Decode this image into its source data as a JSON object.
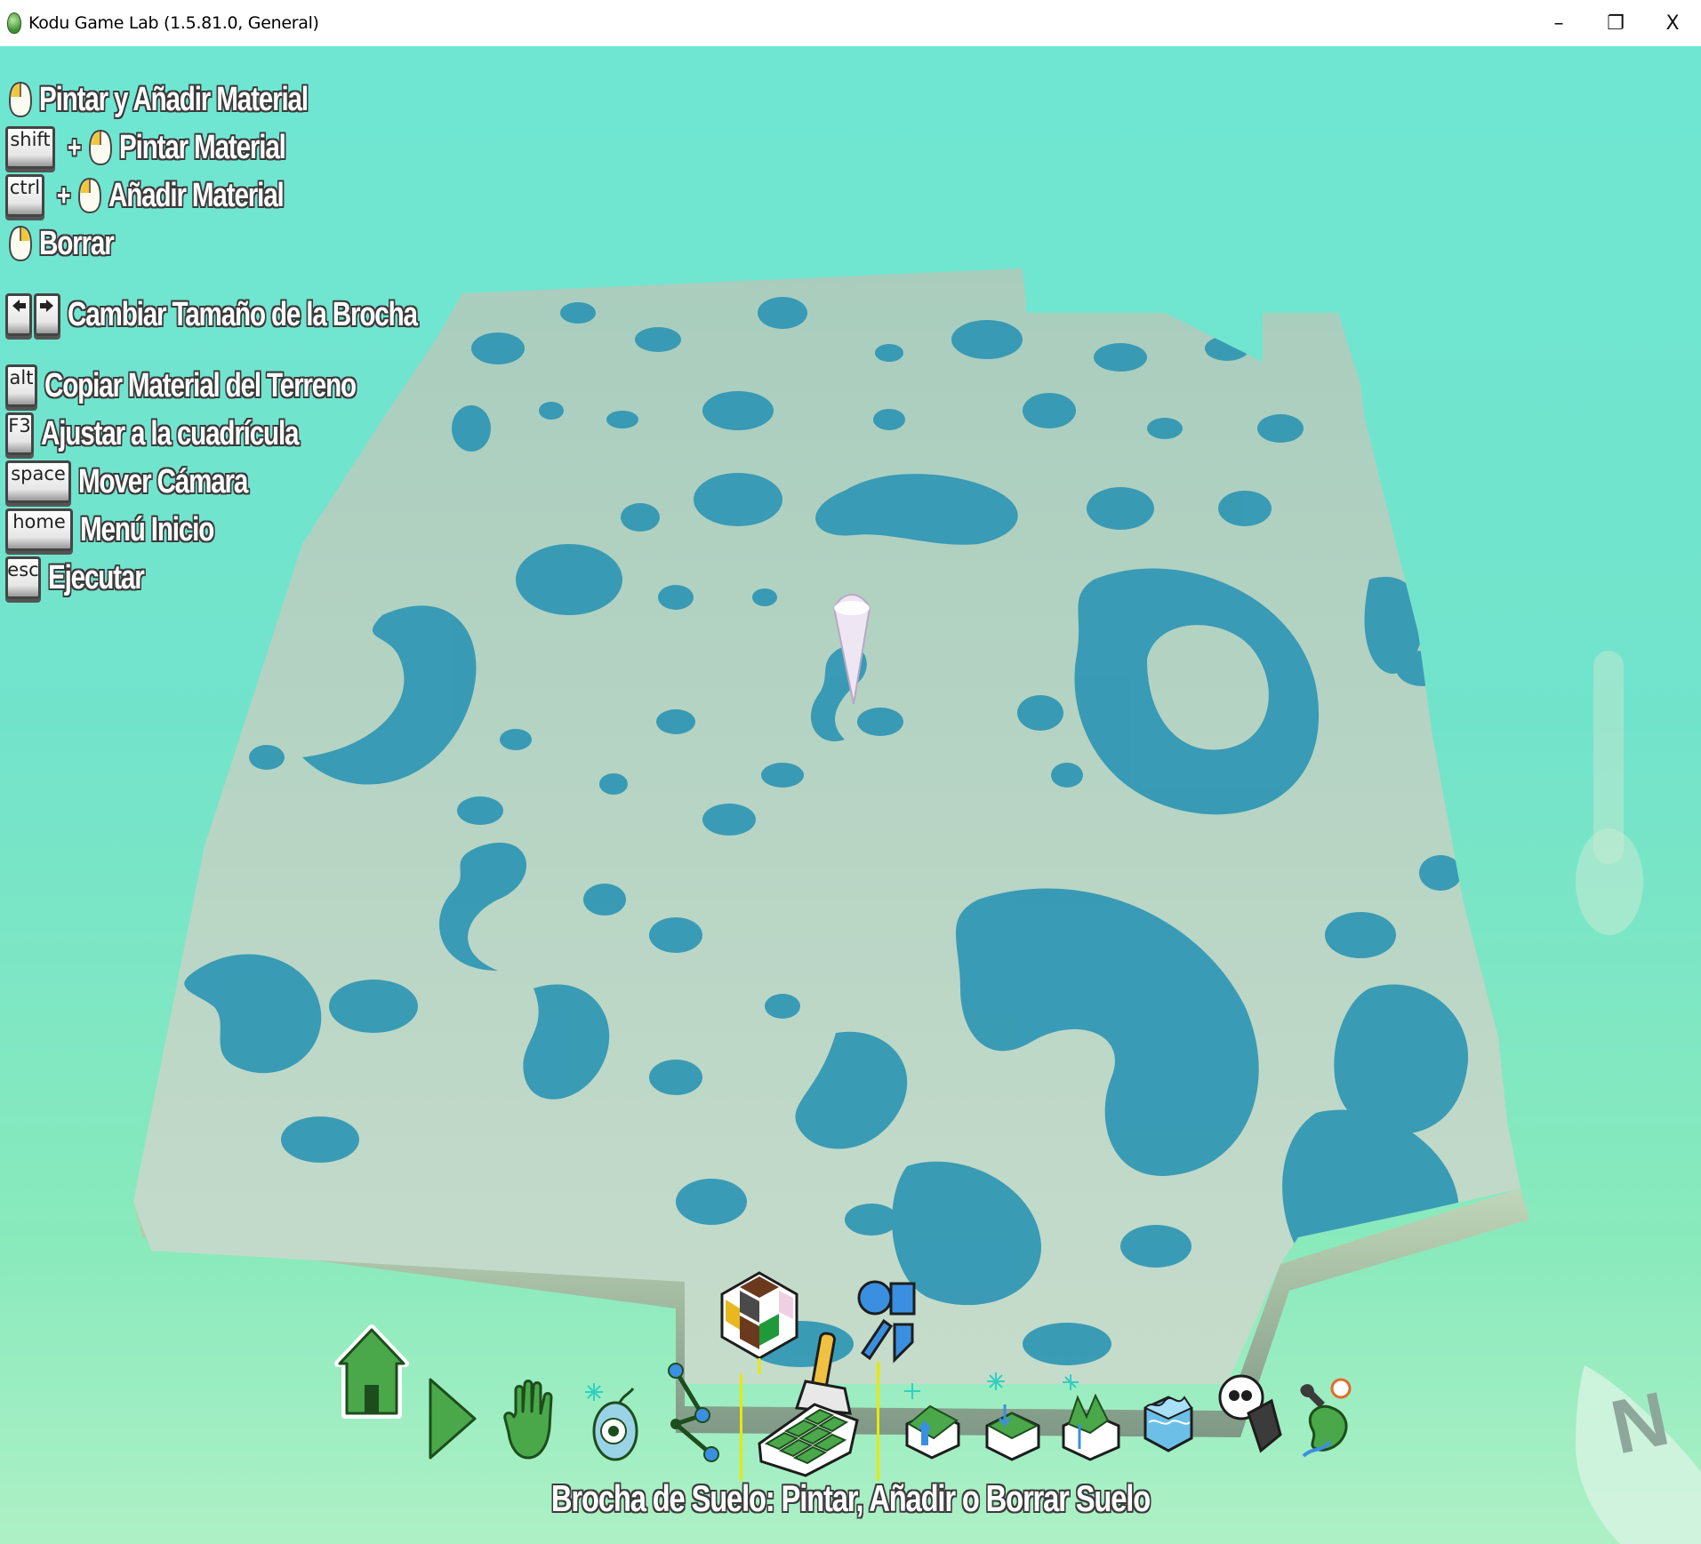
{
  "window": {
    "title": "Kodu Game Lab (1.5.81.0, General)",
    "minimize_glyph": "–",
    "restore_glyph": "❐",
    "close_glyph": "X"
  },
  "help": {
    "paint_add": "Pintar y Añadir Material",
    "shift_key": "shift",
    "paint_only": "Pintar Material",
    "ctrl_key": "ctrl",
    "add_only": "Añadir Material",
    "erase": "Borrar",
    "brush_size": "Cambiar Tamaño de la Brocha",
    "alt_key": "alt",
    "copy_material": "Copiar Material del Terreno",
    "f3_key": "F3",
    "snap_grid": "Ajustar a la cuadrícula",
    "space_key": "space",
    "move_camera": "Mover Cámara",
    "home_key": "home",
    "home_menu": "Menú Inicio",
    "esc_key": "esc",
    "run": "Ejecutar",
    "plus": "+"
  },
  "toolbar": {
    "selected_tool_label": "Brocha de Suelo: Pintar, Añadir o Borrar Suelo",
    "tools": [
      "home-menu",
      "play",
      "move-camera",
      "object",
      "path",
      "ground-brush",
      "up-down",
      "flatten",
      "roughen",
      "water",
      "delete",
      "world-settings"
    ],
    "selected": "ground-brush"
  },
  "compass": {
    "letter": "N"
  },
  "colors": {
    "sky_top": "#6fe6d2",
    "terrain_base": "#bcd8c4",
    "terrain_blob": "#2f96b4",
    "tool_green": "#4aa84a"
  }
}
